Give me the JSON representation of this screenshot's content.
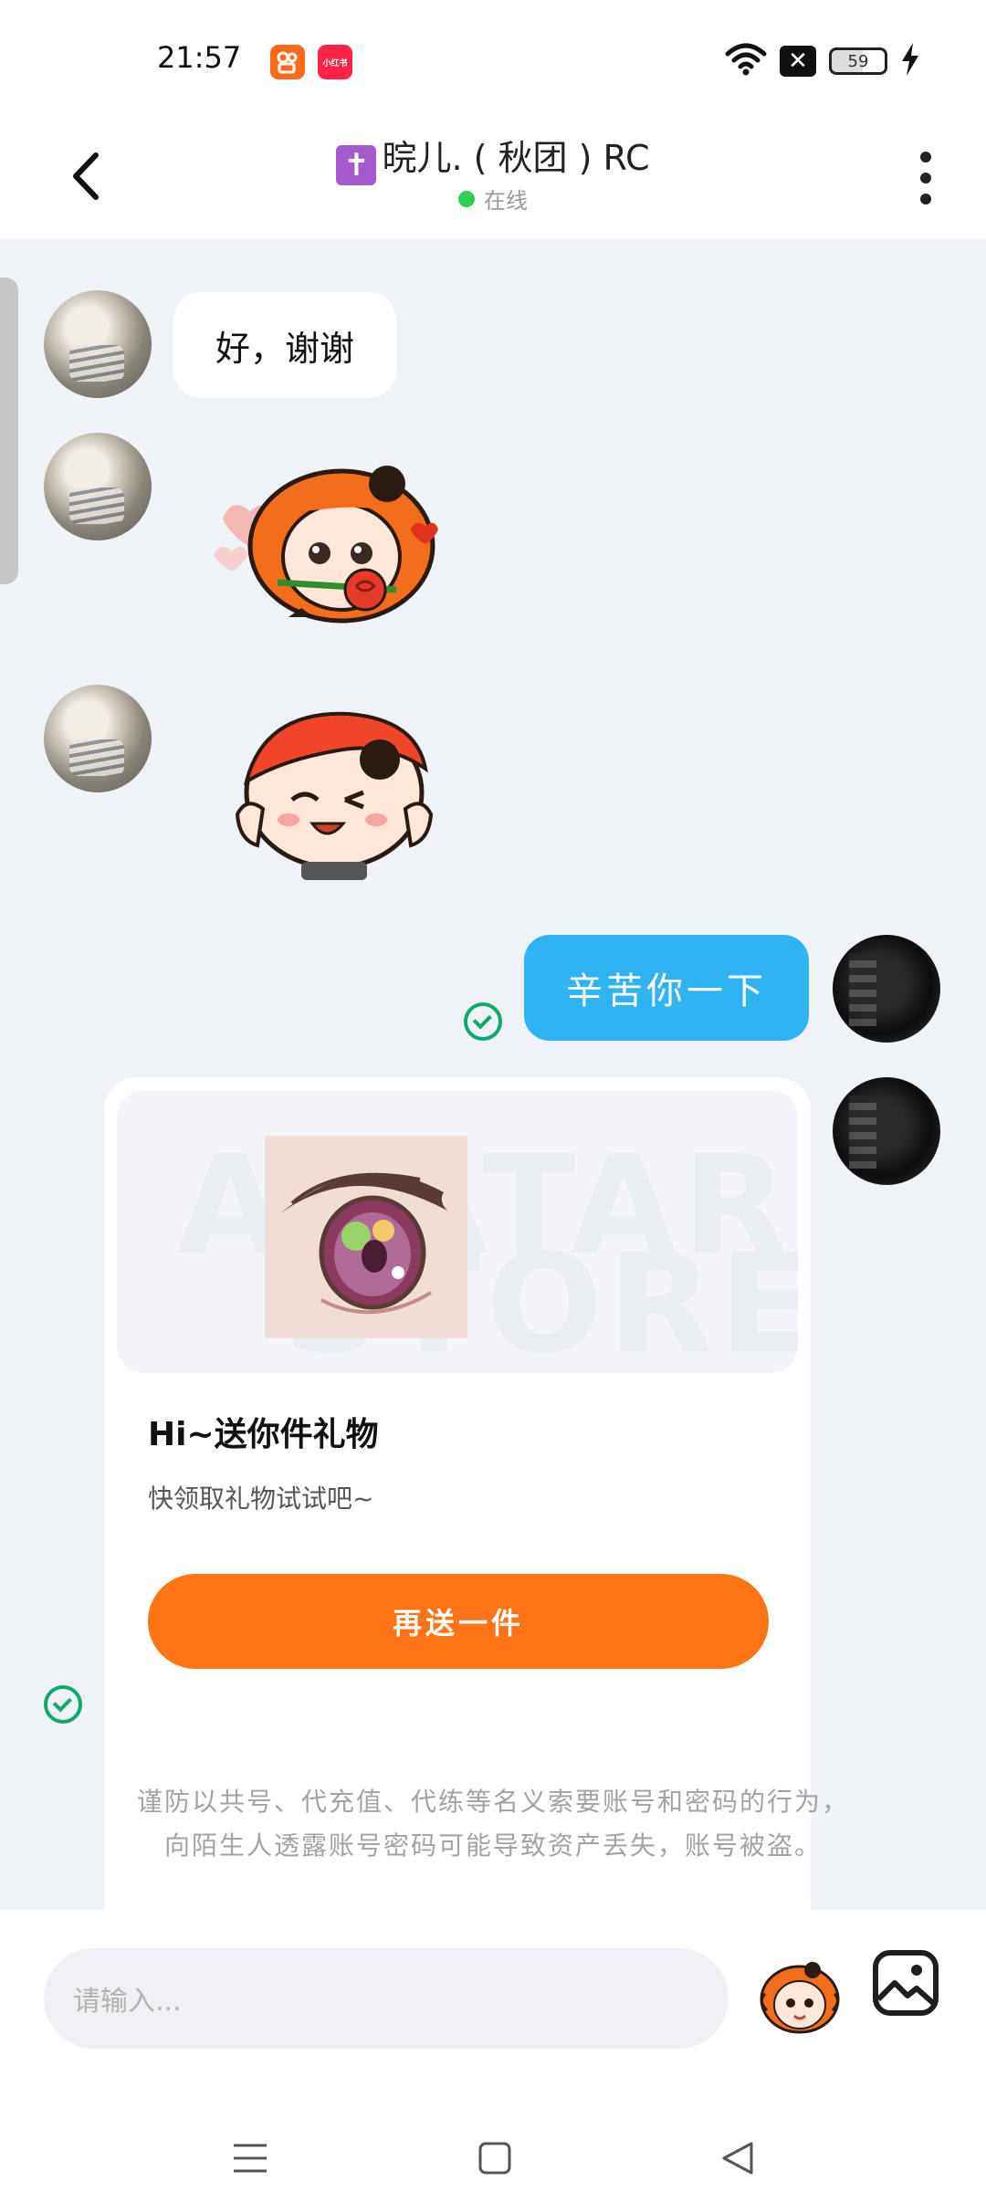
{
  "status_bar": {
    "time": "21:57",
    "app_icons": [
      "kuaishou-icon",
      "xiaohongshu-icon"
    ],
    "app2_label": "小红书",
    "battery": "59",
    "icons": [
      "wifi-icon",
      "x-box-icon",
      "battery-icon",
      "charging-icon"
    ]
  },
  "header": {
    "title": "晥儿.   ( 秋团 ) RC",
    "title_icon": "✝",
    "status": "在线",
    "status_color": "#2fcf57"
  },
  "messages": {
    "incoming_text": "好，谢谢",
    "outgoing_text": "辛苦你一下"
  },
  "gift_card": {
    "banner_watermark_1": "AVATAR",
    "banner_watermark_2": "STORE",
    "title": "Hi~送你件礼物",
    "subtitle": "快领取礼物试试吧~",
    "button_label": "再送一件"
  },
  "notice": {
    "line1": "谨防以共号、代充值、代练等名义索要账号和密码的行为，",
    "line2": "向陌生人透露账号密码可能导致资产丢失，账号被盗。"
  },
  "input": {
    "placeholder": "请输入..."
  },
  "colors": {
    "outgoing_bubble": "#2fb3f2",
    "gift_button": "#ff7416",
    "sent_check": "#13a86b"
  }
}
